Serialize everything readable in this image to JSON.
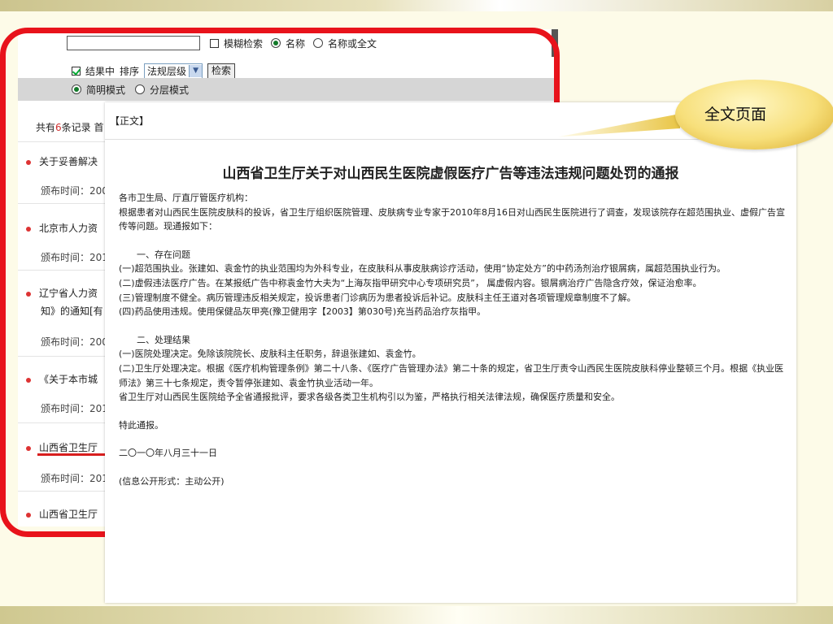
{
  "search": {
    "fuzzy_label": "模糊检索",
    "name_label": "名称",
    "name_fulltext_label": "名称或全文",
    "in_results_label": "结果中",
    "sort_label": "排序",
    "sort_value": "法规层级",
    "search_button": "检索",
    "simple_mode_label": "简明模式",
    "layered_mode_label": "分层模式"
  },
  "results": {
    "count_prefix": "共有",
    "count": "6",
    "count_suffix": "条记录 首",
    "items": [
      {
        "title": "关于妥善解决",
        "date_prefix": "颁布时间：200"
      },
      {
        "title": "北京市人力资",
        "date_prefix": "颁布时间：201"
      },
      {
        "title": "辽宁省人力资",
        "title_line2": "知》的通知[有",
        "date_prefix": "颁布时间：200"
      },
      {
        "title": "《关于本市城",
        "date_prefix": "颁布时间：201"
      },
      {
        "title": "山西省卫生厅",
        "date_prefix": "颁布时间：201"
      },
      {
        "title": "山西省卫生厅"
      }
    ]
  },
  "article": {
    "tag": "【正文】",
    "title": "山西省卫生厅关于对山西民生医院虚假医疗广告等违法违规问题处罚的通报",
    "paragraphs": [
      "各市卫生局、厅直厅管医疗机构：",
      "根据患者对山西民生医院皮肤科的投诉，省卫生厅组织医院管理、皮肤病专业专家于2010年8月16日对山西民生医院进行了调查，发现该院存在超范围执业、虚假广告宣传等问题。现通报如下：",
      "",
      "　　一、存在问题",
      "(一)超范围执业。张建如、袁金竹的执业范围均为外科专业，在皮肤科从事皮肤病诊疗活动，使用“协定处方”的中药汤剂治疗银屑病，属超范围执业行为。",
      "(二)虚假违法医疗广告。在某报纸广告中称袁金竹大夫为“上海灰指甲研究中心专项研究员”， 属虚假内容。银屑病治疗广告隐含疗效，保证治愈率。",
      "(三)管理制度不健全。病历管理违反相关规定，投诉患者门诊病历为患者投诉后补记。皮肤科主任王道对各项管理规章制度不了解。",
      "(四)药品使用违规。使用保健品灰甲亮(豫卫健用字【2003】第030号)充当药品治疗灰指甲。",
      "",
      "　　二、处理结果",
      "(一)医院处理决定。免除该院院长、皮肤科主任职务，辞退张建如、袁金竹。",
      "(二)卫生厅处理决定。根据《医疗机构管理条例》第二十八条、《医疗广告管理办法》第二十条的规定，省卫生厅责令山西民生医院皮肤科停业整顿三个月。根据《执业医师法》第三十七条规定，责令暂停张建如、袁金竹执业活动一年。",
      "省卫生厅对山西民生医院给予全省通报批评，要求各级各类卫生机构引以为鉴，严格执行相关法律法规，确保医疗质量和安全。",
      "",
      "特此通报。",
      "",
      "二〇一〇年八月三十一日",
      "",
      "(信息公开形式：主动公开)"
    ]
  },
  "callout": {
    "text": "全文页面"
  },
  "colors": {
    "frame": "#e8131b",
    "callout": "#f7df7a",
    "bullet": "#dd3333"
  }
}
